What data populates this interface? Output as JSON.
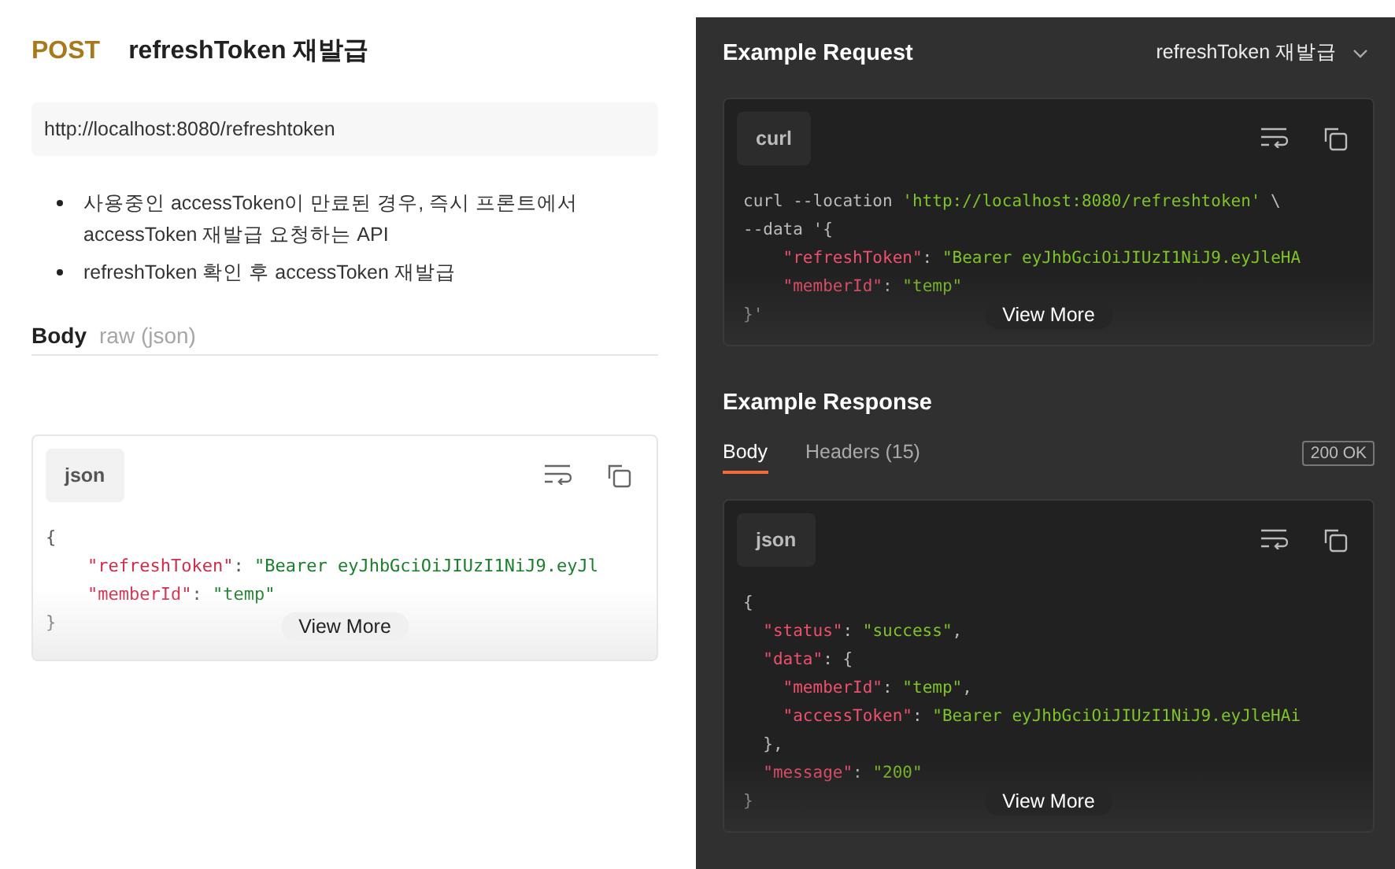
{
  "request": {
    "method": "POST",
    "name": "refreshToken 재발급",
    "url": "http://localhost:8080/refreshtoken",
    "description": [
      "사용중인 accessToken이 만료된 경우, 즉시 프론트에서 accessToken 재발급 요청하는 API",
      "refreshToken 확인 후 accessToken 재발급"
    ],
    "body": {
      "title": "Body",
      "mode": "raw (json)",
      "language": "json",
      "view_more": "View More",
      "lines": [
        [
          {
            "kind": "punct",
            "text": "{"
          }
        ],
        [
          {
            "kind": "key",
            "text": "    \"refreshToken\""
          },
          {
            "kind": "punct",
            "text": ": "
          },
          {
            "kind": "string",
            "text": "\"Bearer eyJhbGciOiJIUzI1NiJ9.eyJl"
          }
        ],
        [
          {
            "kind": "key",
            "text": "    \"memberId\""
          },
          {
            "kind": "punct",
            "text": ": "
          },
          {
            "kind": "string",
            "text": "\"temp\""
          }
        ],
        [
          {
            "kind": "punct",
            "text": "}"
          }
        ]
      ]
    }
  },
  "example_request": {
    "title": "Example Request",
    "selector": "refreshToken 재발급",
    "language": "curl",
    "view_more": "View More",
    "lines": [
      [
        {
          "kind": "plain",
          "text": "curl --location "
        },
        {
          "kind": "string",
          "text": "'http://localhost:8080/refreshtoken'"
        },
        {
          "kind": "plain",
          "text": " \\"
        }
      ],
      [
        {
          "kind": "plain",
          "text": "--data '{"
        }
      ],
      [
        {
          "kind": "key",
          "text": "    \"refreshToken\""
        },
        {
          "kind": "punct",
          "text": ": "
        },
        {
          "kind": "string",
          "text": "\"Bearer eyJhbGciOiJIUzI1NiJ9.eyJleHA"
        }
      ],
      [
        {
          "kind": "key",
          "text": "    \"memberId\""
        },
        {
          "kind": "punct",
          "text": ": "
        },
        {
          "kind": "string",
          "text": "\"temp\""
        }
      ],
      [
        {
          "kind": "plain",
          "text": "}'"
        }
      ]
    ]
  },
  "example_response": {
    "title": "Example Response",
    "tabs": [
      {
        "label": "Body",
        "selected": true
      },
      {
        "label": "Headers (15)",
        "selected": false
      }
    ],
    "status": "200 OK",
    "language": "json",
    "view_more": "View More",
    "lines": [
      [
        {
          "kind": "punct",
          "text": "{"
        }
      ],
      [
        {
          "kind": "key",
          "text": "  \"status\""
        },
        {
          "kind": "punct",
          "text": ": "
        },
        {
          "kind": "string",
          "text": "\"success\""
        },
        {
          "kind": "punct",
          "text": ","
        }
      ],
      [
        {
          "kind": "key",
          "text": "  \"data\""
        },
        {
          "kind": "punct",
          "text": ": {"
        }
      ],
      [
        {
          "kind": "key",
          "text": "    \"memberId\""
        },
        {
          "kind": "punct",
          "text": ": "
        },
        {
          "kind": "string",
          "text": "\"temp\""
        },
        {
          "kind": "punct",
          "text": ","
        }
      ],
      [
        {
          "kind": "key",
          "text": "    \"accessToken\""
        },
        {
          "kind": "punct",
          "text": ": "
        },
        {
          "kind": "string",
          "text": "\"Bearer eyJhbGciOiJIUzI1NiJ9.eyJleHAi"
        }
      ],
      [
        {
          "kind": "punct",
          "text": "  },"
        }
      ],
      [
        {
          "kind": "key",
          "text": "  \"message\""
        },
        {
          "kind": "punct",
          "text": ": "
        },
        {
          "kind": "string",
          "text": "\"200\""
        }
      ],
      [
        {
          "kind": "punct",
          "text": "}"
        }
      ]
    ]
  }
}
